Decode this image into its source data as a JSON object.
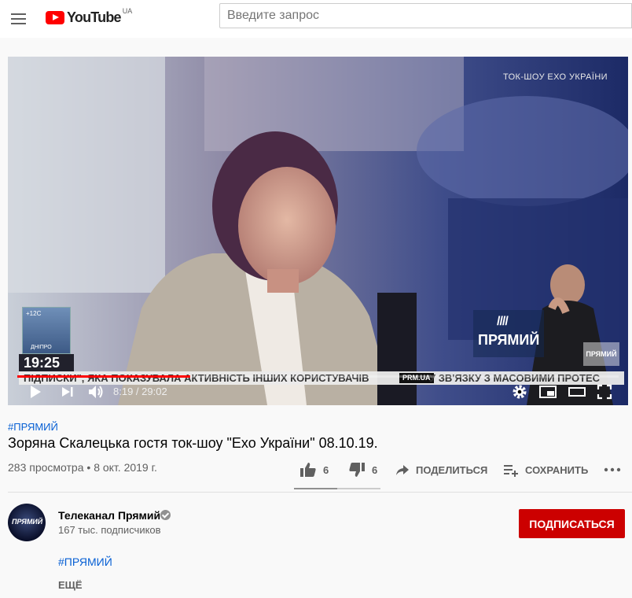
{
  "masthead": {
    "logo_text": "YouTube",
    "country_code": "UA",
    "search_placeholder": "Введите запрос"
  },
  "player": {
    "overlay": {
      "show_logo": "ТОК-ШОУ ЕХО УКРАЇНИ",
      "weather_temp": "+12C",
      "weather_city": "ДНІПРО",
      "clock": "19:25",
      "ticker_left": "ПІДПИСКИ\", ЯКА ПОКАЗУВАЛА АКТИВНІСТЬ ІНШИХ КОРИСТУВАЧІВ",
      "ticker_site": "PRM.UA",
      "ticker_right": "У ЗВ'ЯЗКУ З МАСОВИМИ ПРОТЕС",
      "channel_brand": "ПРЯМИЙ",
      "channel_brand_bars": "////",
      "watermark": "ПРЯМИЙ"
    },
    "time_current": "8:19",
    "time_separator": " / ",
    "time_total": "29:02",
    "progress_played": 0.287,
    "progress_loaded": 0.29
  },
  "video": {
    "hashtag": "#ПРЯМИЙ",
    "title": "Зоряна Скалецька гостя ток-шоу \"Ехо України\" 08.10.19.",
    "views": "283 просмотра",
    "separator": " • ",
    "date": "8 окт. 2019 г.",
    "likes": "6",
    "dislikes": "6",
    "share_label": "ПОДЕЛИТЬСЯ",
    "save_label": "СОХРАНИТЬ",
    "like_ratio": 0.5
  },
  "channel": {
    "name": "Телеканал Прямий",
    "subscribers": "167 тыс. подписчиков",
    "subscribe_label": "ПОДПИСАТЬСЯ",
    "avatar_text": "ПРЯМИЙ"
  },
  "description": {
    "hashtag": "#ПРЯМИЙ",
    "more_label": "ЕЩЁ"
  }
}
